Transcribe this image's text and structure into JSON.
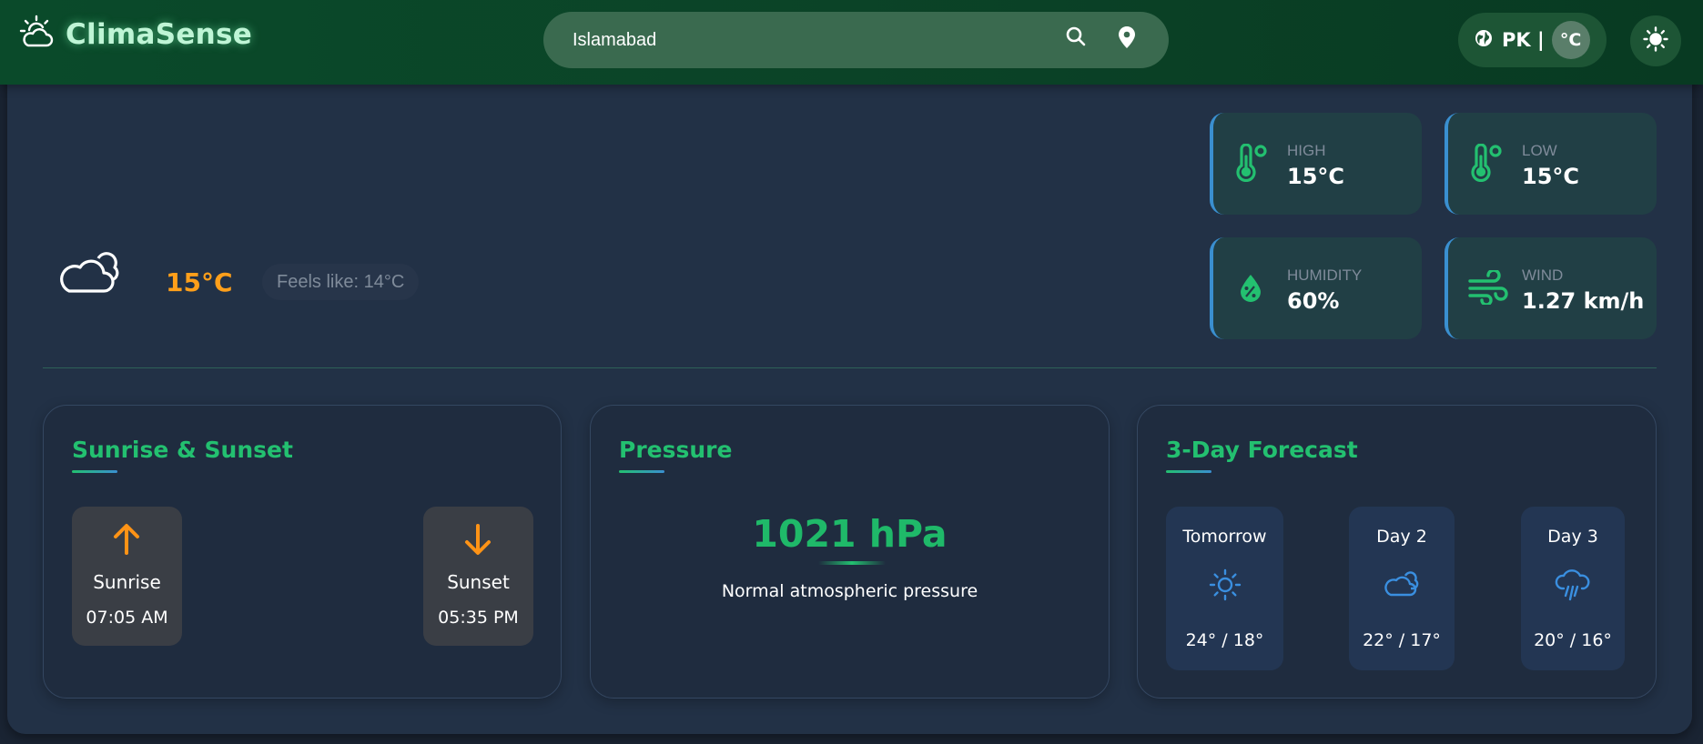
{
  "header": {
    "app_name": "ClimaSense",
    "search": {
      "value": "Islamabad",
      "placeholder": ""
    },
    "country": "PK |",
    "unit": "°C"
  },
  "current": {
    "temp": "15°C",
    "feels_like": "Feels like: 14°C",
    "condition_icon": "cloud-icon"
  },
  "stats": [
    {
      "label": "HIGH",
      "value": "15°C",
      "icon": "thermometer-icon"
    },
    {
      "label": "LOW",
      "value": "15°C",
      "icon": "thermometer-icon"
    },
    {
      "label": "HUMIDITY",
      "value": "60%",
      "icon": "humidity-drop-icon"
    },
    {
      "label": "WIND",
      "value": "1.27 km/h",
      "icon": "wind-icon"
    }
  ],
  "sun": {
    "title": "Sunrise & Sunset",
    "sunrise_label": "Sunrise",
    "sunrise_time": "07:05 AM",
    "sunset_label": "Sunset",
    "sunset_time": "05:35 PM"
  },
  "pressure": {
    "title": "Pressure",
    "value": "1021 hPa",
    "description": "Normal atmospheric pressure"
  },
  "forecast": {
    "title": "3-Day Forecast",
    "days": [
      {
        "day": "Tomorrow",
        "temps": "24° / 18°",
        "icon": "sun-icon"
      },
      {
        "day": "Day 2",
        "temps": "22° / 17°",
        "icon": "cloud-icon"
      },
      {
        "day": "Day 3",
        "temps": "20° / 16°",
        "icon": "rain-cloud-icon"
      }
    ]
  },
  "colors": {
    "accent_green": "#23c070",
    "temp_orange": "#ff9f1a",
    "header_green": "#0a4a2a",
    "forecast_icon_blue": "#3a8fe0"
  }
}
